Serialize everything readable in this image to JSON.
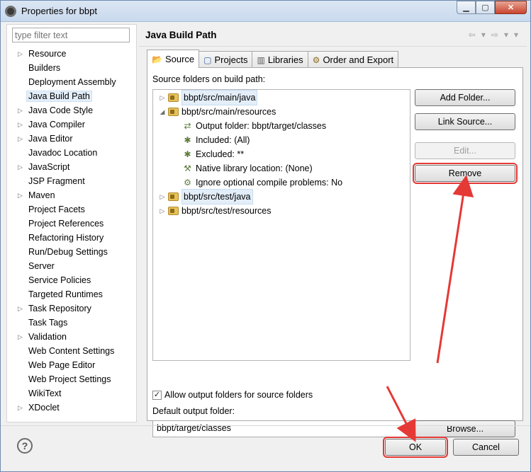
{
  "window": {
    "title": "Properties for bbpt",
    "min_glyph": "▁",
    "max_glyph": "▢",
    "close_glyph": "✕"
  },
  "filter": {
    "placeholder": "type filter text"
  },
  "categories": [
    {
      "label": "Resource",
      "expandable": true
    },
    {
      "label": "Builders",
      "expandable": false
    },
    {
      "label": "Deployment Assembly",
      "expandable": false
    },
    {
      "label": "Java Build Path",
      "expandable": false,
      "selected": true
    },
    {
      "label": "Java Code Style",
      "expandable": true
    },
    {
      "label": "Java Compiler",
      "expandable": true
    },
    {
      "label": "Java Editor",
      "expandable": true
    },
    {
      "label": "Javadoc Location",
      "expandable": false
    },
    {
      "label": "JavaScript",
      "expandable": true
    },
    {
      "label": "JSP Fragment",
      "expandable": false
    },
    {
      "label": "Maven",
      "expandable": true
    },
    {
      "label": "Project Facets",
      "expandable": false
    },
    {
      "label": "Project References",
      "expandable": false
    },
    {
      "label": "Refactoring History",
      "expandable": false
    },
    {
      "label": "Run/Debug Settings",
      "expandable": false
    },
    {
      "label": "Server",
      "expandable": false
    },
    {
      "label": "Service Policies",
      "expandable": false
    },
    {
      "label": "Targeted Runtimes",
      "expandable": false
    },
    {
      "label": "Task Repository",
      "expandable": true
    },
    {
      "label": "Task Tags",
      "expandable": false
    },
    {
      "label": "Validation",
      "expandable": true
    },
    {
      "label": "Web Content Settings",
      "expandable": false
    },
    {
      "label": "Web Page Editor",
      "expandable": false
    },
    {
      "label": "Web Project Settings",
      "expandable": false
    },
    {
      "label": "WikiText",
      "expandable": false
    },
    {
      "label": "XDoclet",
      "expandable": true
    }
  ],
  "page": {
    "title": "Java Build Path",
    "nav": {
      "back": "⇦",
      "back_menu": "▾",
      "forward": "⇨",
      "forward_menu": "▾",
      "view_menu": "▾"
    }
  },
  "tabs": [
    {
      "label": "Source",
      "active": true
    },
    {
      "label": "Projects",
      "active": false
    },
    {
      "label": "Libraries",
      "active": false
    },
    {
      "label": "Order and Export",
      "active": false
    }
  ],
  "source": {
    "heading": "Source folders on build path:",
    "rows": [
      {
        "label": "bbpt/src/main/java",
        "expander": "▷",
        "kind": "folder",
        "selected": true
      },
      {
        "label": "bbpt/src/main/resources",
        "expander": "◢",
        "kind": "folder",
        "selected": false
      },
      {
        "label": "Output folder: bbpt/target/classes",
        "kind": "output"
      },
      {
        "label": "Included: (All)",
        "kind": "filter"
      },
      {
        "label": "Excluded: **",
        "kind": "filter"
      },
      {
        "label": "Native library location: (None)",
        "kind": "native"
      },
      {
        "label": "Ignore optional compile problems: No",
        "kind": "ignore"
      },
      {
        "label": "bbpt/src/test/java",
        "expander": "▷",
        "kind": "folder",
        "selected": true
      },
      {
        "label": "bbpt/src/test/resources",
        "expander": "▷",
        "kind": "folder",
        "selected": false
      }
    ],
    "buttons": {
      "add_folder": "Add Folder...",
      "link_source": "Link Source...",
      "edit": "Edit...",
      "remove": "Remove"
    },
    "allow_output_label": "Allow output folders for source folders",
    "allow_output_checked": true,
    "check_glyph": "✓",
    "default_output_label": "Default output folder:",
    "default_output_value": "bbpt/target/classes",
    "browse": "Browse..."
  },
  "footer": {
    "ok": "OK",
    "cancel": "Cancel",
    "help_glyph": "?"
  },
  "colors": {
    "highlight": "#e53935",
    "selection": "#e3eef9"
  }
}
